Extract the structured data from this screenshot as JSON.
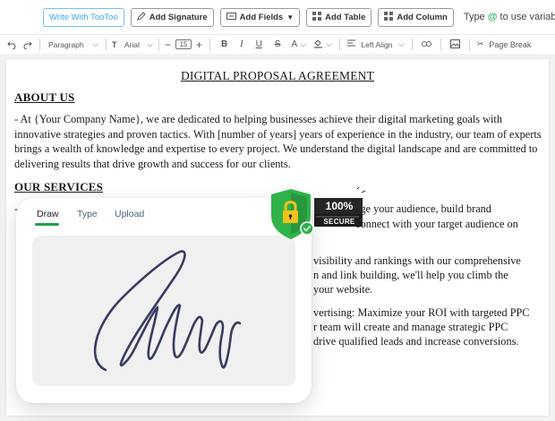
{
  "topbar": {
    "ai_button": "Write With TooToo",
    "add_signature": "Add Signature",
    "add_fields": "Add Fields",
    "add_table": "Add Table",
    "add_column": "Add Column",
    "hint_prefix": "Type ",
    "hint_symbol": "@",
    "hint_suffix": " to use variables"
  },
  "toolbar": {
    "paragraph_style": "Paragraph",
    "font_family": "Arial",
    "font_size": "15",
    "alignment": "Left Align",
    "page_break": "Page Break"
  },
  "document": {
    "title": "DIGITAL PROPOSAL AGREEMENT",
    "about_heading": "ABOUT US",
    "about_text": "- At {Your Company Name}, we are dedicated to helping businesses achieve their digital marketing goals with innovative strategies and proven tactics. With [number of years] years of experience in the industry, our team of experts brings a wealth of knowledge and expertise to every project. We understand the digital landscape and are committed to delivering results that drive growth and success for our clients.",
    "services_heading": "OUR SERVICES",
    "services_fragments": {
      "line1_start": "- S",
      "line1_end": "age your audience, build brand",
      "line2_end": "connect with your target audience on",
      "line3_end": "visibility and rankings with our comprehensive",
      "line4_end": "n and link building, we'll help you climb the",
      "line5_end": "your website.",
      "line6_end": "vertising: Maximize your ROI with targeted PPC",
      "line7_end": "r team will create and manage strategic PPC",
      "line8_end": "drive qualified leads and increase conversions."
    }
  },
  "signature_panel": {
    "tabs": [
      "Draw",
      "Type",
      "Upload"
    ],
    "active_tab": "Draw",
    "accent_color": "#1fa34a"
  },
  "badge": {
    "percent": "100%",
    "label": "SECURE",
    "shield_color": "#2fb34a"
  }
}
